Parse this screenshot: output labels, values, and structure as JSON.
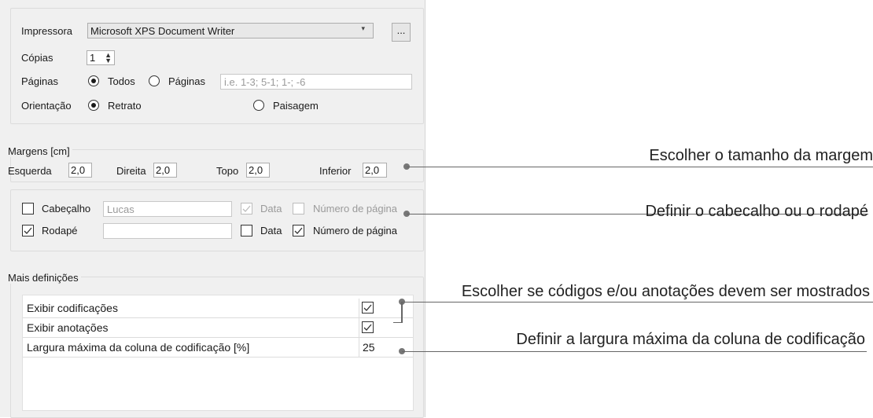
{
  "printer": {
    "label": "Impressora",
    "value": "Microsoft XPS Document Writer",
    "more_button": "..."
  },
  "copies": {
    "label": "Cópias",
    "value": "1"
  },
  "pages": {
    "label": "Páginas",
    "opt_all": "Todos",
    "opt_pages": "Páginas",
    "range_placeholder": "i.e. 1-3; 5-1; 1-; -6"
  },
  "orientation": {
    "label": "Orientação",
    "portrait": "Retrato",
    "landscape": "Paisagem"
  },
  "margins": {
    "title": "Margens [cm]",
    "left_label": "Esquerda",
    "left": "2,0",
    "right_label": "Direita",
    "right": "2,0",
    "top_label": "Topo",
    "top": "2,0",
    "bottom_label": "Inferior",
    "bottom": "2,0"
  },
  "header": {
    "label": "Cabeçalho",
    "placeholder": "Lucas",
    "date": "Data",
    "page_number": "Número de página"
  },
  "footer": {
    "label": "Rodapé",
    "value": "",
    "date": "Data",
    "page_number": "Número de página"
  },
  "more_settings": {
    "title": "Mais definições",
    "rows": [
      {
        "label": "Exibir codificações",
        "checked": true
      },
      {
        "label": "Exibir anotações",
        "checked": true
      },
      {
        "label": "Largura máxima da coluna de codificação [%]",
        "value": "25"
      }
    ]
  },
  "callouts": {
    "margin": "Escolher o tamanho da margem",
    "header_footer": "Definir o cabecalho ou o rodapé",
    "codes": "Escolher se códigos e/ou anotações devem ser mostrados",
    "width": "Definir a largura máxima da coluna de codificação"
  }
}
